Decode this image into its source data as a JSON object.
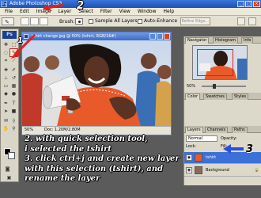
{
  "window": {
    "title": "Adobe Photoshop CS3",
    "icon_text": "Ps",
    "buttons": [
      "_",
      "□",
      "×"
    ]
  },
  "menubar": [
    "File",
    "Edit",
    "Image",
    "Layer",
    "Select",
    "Filter",
    "View",
    "Window",
    "Help"
  ],
  "options_bar": {
    "brush_label": "Brush:",
    "sample_all_layers": "Sample All Layers",
    "auto_enhance": "Auto-Enhance",
    "refine_edge": "Refine Edge..."
  },
  "toolbox": {
    "badge": "Ps"
  },
  "document": {
    "title": "tshirt change.jpg @ 50% (tshirt, RGB/16#)",
    "zoom": "50%",
    "info": "Doc: 1.20M/2.80M"
  },
  "navigator": {
    "tabs": [
      "Navigator",
      "Histogram",
      "Info"
    ],
    "zoom": "50%"
  },
  "color_tabs": [
    "Color",
    "Swatches",
    "Styles"
  ],
  "layers": {
    "tabs": [
      "Layers",
      "Channels",
      "Paths"
    ],
    "blend_mode": "Normal",
    "opacity_label": "Opacity:",
    "lock_label": "Lock:",
    "fill_label": "Fill:",
    "items": [
      {
        "name": "tshirt",
        "selected": true
      },
      {
        "name": "Background",
        "selected": false,
        "locked": true
      }
    ]
  },
  "annotations": {
    "step_2_top": "2",
    "step_1": "1",
    "step_3": "3",
    "lines": [
      "2. with quick selection tool,",
      "i selected the tshirt",
      "3. click ctrl+j and create new layer",
      "with this selection (tshirt), and",
      "rename the layer"
    ]
  },
  "colors": {
    "arrow_red": "#e02020",
    "arrow_blue": "#2a4fe0",
    "shirt": "#e85a2a",
    "selection_blue": "#3d6fd8"
  }
}
